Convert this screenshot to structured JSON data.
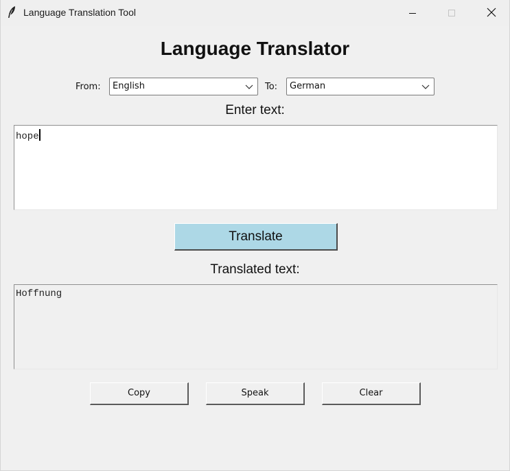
{
  "window": {
    "title": "Language Translation Tool",
    "icons": {
      "app": "feather-icon",
      "minimize": "minimize-icon",
      "maximize": "maximize-icon",
      "close": "close-icon"
    }
  },
  "main": {
    "heading": "Language Translator",
    "from_label": "From:",
    "from_value": "English",
    "to_label": "To:",
    "to_value": "German",
    "enter_label": "Enter text:",
    "input_text": "hope",
    "translate_label": "Translate",
    "translated_label": "Translated text:",
    "output_text": "Hoffnung",
    "buttons": {
      "copy": "Copy",
      "speak": "Speak",
      "clear": "Clear"
    }
  },
  "colors": {
    "translate_button": "#add8e6",
    "background": "#f0f0f0"
  }
}
